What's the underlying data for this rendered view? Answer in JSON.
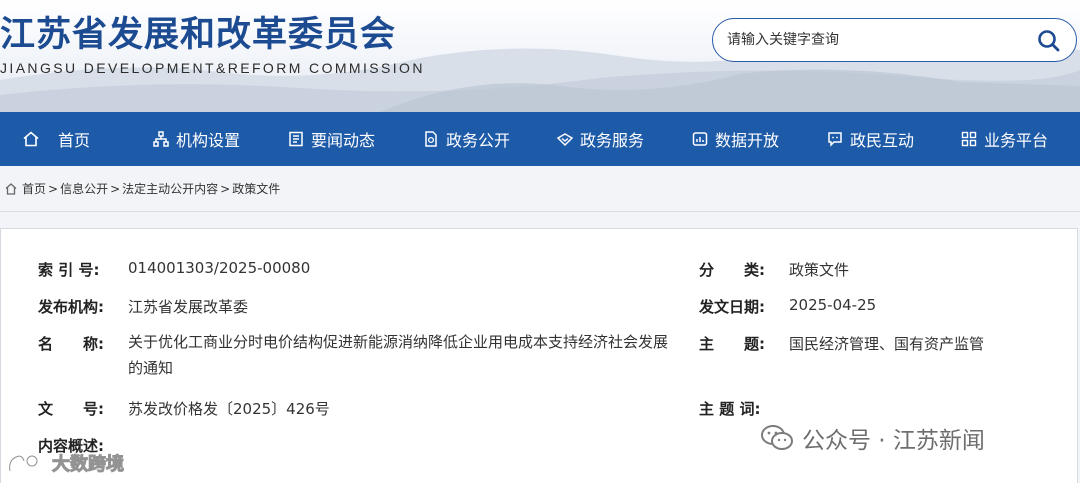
{
  "header": {
    "title": "江苏省发展和改革委员会",
    "subtitle": "JIANGSU DEVELOPMENT&REFORM COMMISSION"
  },
  "search": {
    "placeholder": "请输入关键字查询",
    "icon": "search-icon"
  },
  "nav": {
    "items": [
      {
        "label": "首页",
        "icon": "home-icon"
      },
      {
        "label": "机构设置",
        "icon": "org-icon"
      },
      {
        "label": "要闻动态",
        "icon": "news-icon"
      },
      {
        "label": "政务公开",
        "icon": "doc-icon"
      },
      {
        "label": "政务服务",
        "icon": "service-icon"
      },
      {
        "label": "数据开放",
        "icon": "data-icon"
      },
      {
        "label": "政民互动",
        "icon": "chat-icon"
      },
      {
        "label": "业务平台",
        "icon": "grid-icon"
      }
    ]
  },
  "breadcrumb": {
    "items": [
      "首页",
      "信息公开",
      "法定主动公开内容",
      "政策文件"
    ],
    "separator": ">"
  },
  "info": {
    "index_label": "索 引 号:",
    "index_value": "014001303/2025-00080",
    "category_label": "分　　类:",
    "category_value": "政策文件",
    "publisher_label": "发布机构:",
    "publisher_value": "江苏省发展改革委",
    "date_label": "发文日期:",
    "date_value": "2025-04-25",
    "name_label": "名　　称:",
    "name_value": "关于优化工商业分时电价结构促进新能源消纳降低企业用电成本支持经济社会发展的通知",
    "topic_label": "主　　题:",
    "topic_value": "国民经济管理、国有资产监管",
    "docnum_label": "文　　号:",
    "docnum_value": "苏发改价格发〔2025〕426号",
    "keywords_label": "主 题 词:",
    "summary_label": "内容概述:"
  },
  "watermarks": {
    "wechat": "公众号 · 江苏新闻",
    "source": "大数跨境"
  },
  "colors": {
    "brand": "#1c4b92",
    "nav_bg": "#1d5aa8"
  }
}
